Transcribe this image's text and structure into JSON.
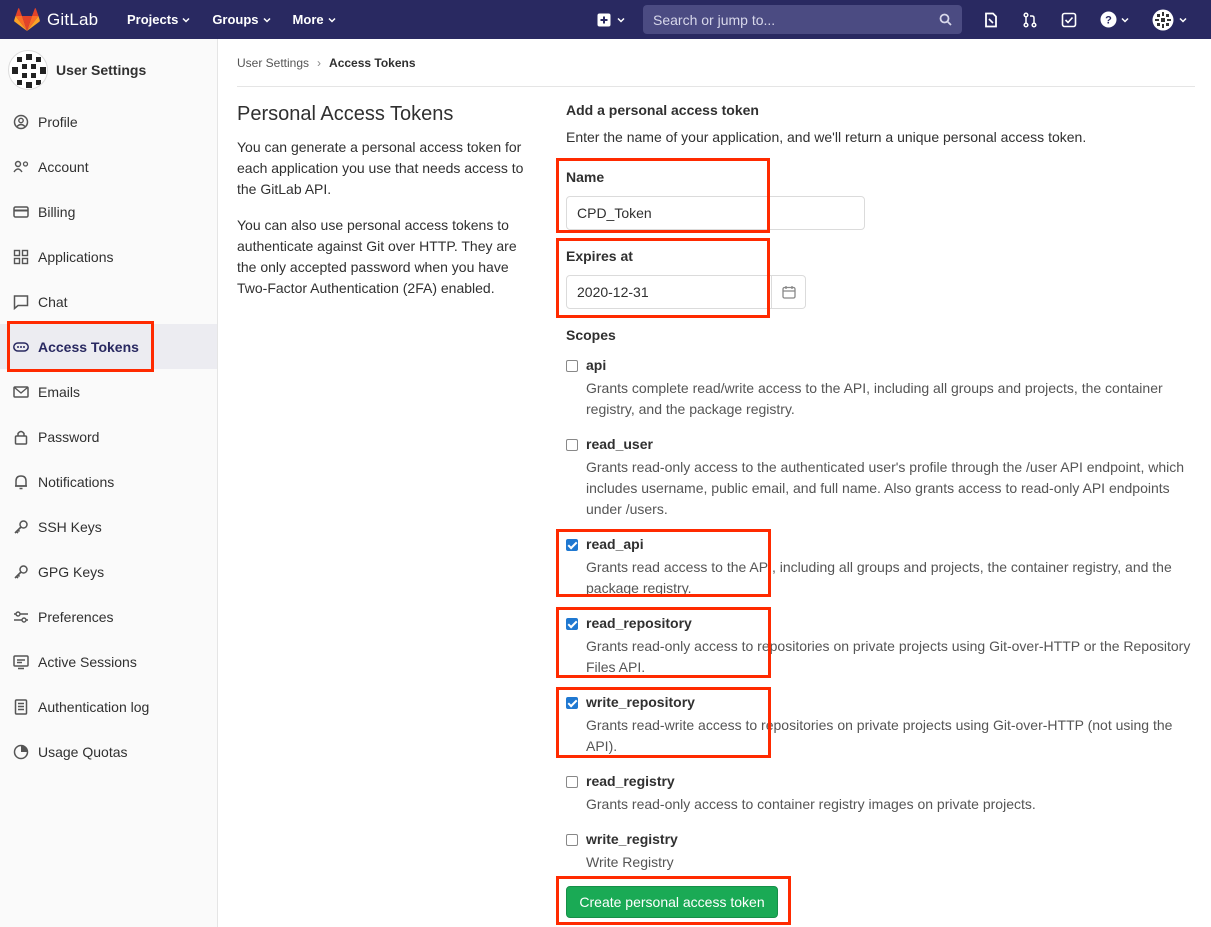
{
  "navbar": {
    "brand": "GitLab",
    "menu": [
      {
        "label": "Projects"
      },
      {
        "label": "Groups"
      },
      {
        "label": "More"
      }
    ],
    "search_placeholder": "Search or jump to..."
  },
  "sidebar": {
    "title": "User Settings",
    "items": [
      {
        "label": "Profile",
        "icon": "profile-icon"
      },
      {
        "label": "Account",
        "icon": "account-icon"
      },
      {
        "label": "Billing",
        "icon": "billing-icon"
      },
      {
        "label": "Applications",
        "icon": "applications-icon"
      },
      {
        "label": "Chat",
        "icon": "chat-icon"
      },
      {
        "label": "Access Tokens",
        "icon": "token-icon",
        "active": true
      },
      {
        "label": "Emails",
        "icon": "mail-icon"
      },
      {
        "label": "Password",
        "icon": "lock-icon"
      },
      {
        "label": "Notifications",
        "icon": "bell-icon"
      },
      {
        "label": "SSH Keys",
        "icon": "key-icon"
      },
      {
        "label": "GPG Keys",
        "icon": "key-icon"
      },
      {
        "label": "Preferences",
        "icon": "preferences-icon"
      },
      {
        "label": "Active Sessions",
        "icon": "monitor-icon"
      },
      {
        "label": "Authentication log",
        "icon": "log-icon"
      },
      {
        "label": "Usage Quotas",
        "icon": "quota-icon"
      }
    ]
  },
  "breadcrumb": {
    "parent": "User Settings",
    "current": "Access Tokens"
  },
  "intro": {
    "title": "Personal Access Tokens",
    "p1": "You can generate a personal access token for each application you use that needs access to the GitLab API.",
    "p2": "You can also use personal access tokens to authenticate against Git over HTTP. They are the only accepted password when you have Two-Factor Authentication (2FA) enabled."
  },
  "form": {
    "title": "Add a personal access token",
    "description": "Enter the name of your application, and we'll return a unique personal access token.",
    "name_label": "Name",
    "name_value": "CPD_Token",
    "expires_label": "Expires at",
    "expires_value": "2020-12-31",
    "scopes_label": "Scopes",
    "scopes": [
      {
        "name": "api",
        "checked": false,
        "description": "Grants complete read/write access to the API, including all groups and projects, the container registry, and the package registry."
      },
      {
        "name": "read_user",
        "checked": false,
        "description": "Grants read-only access to the authenticated user's profile through the /user API endpoint, which includes username, public email, and full name. Also grants access to read-only API endpoints under /users."
      },
      {
        "name": "read_api",
        "checked": true,
        "description": "Grants read access to the API, including all groups and projects, the container registry, and the package registry."
      },
      {
        "name": "read_repository",
        "checked": true,
        "description": "Grants read-only access to repositories on private projects using Git-over-HTTP or the Repository Files API."
      },
      {
        "name": "write_repository",
        "checked": true,
        "description": "Grants read-write access to repositories on private projects using Git-over-HTTP (not using the API)."
      },
      {
        "name": "read_registry",
        "checked": false,
        "description": "Grants read-only access to container registry images on private projects."
      },
      {
        "name": "write_registry",
        "checked": false,
        "description": "Write Registry"
      }
    ],
    "submit_label": "Create personal access token"
  },
  "colors": {
    "navbar": "#292961",
    "highlight": "#ff2a00",
    "submit": "#1aaa55",
    "checkbox": "#1f78d1"
  }
}
